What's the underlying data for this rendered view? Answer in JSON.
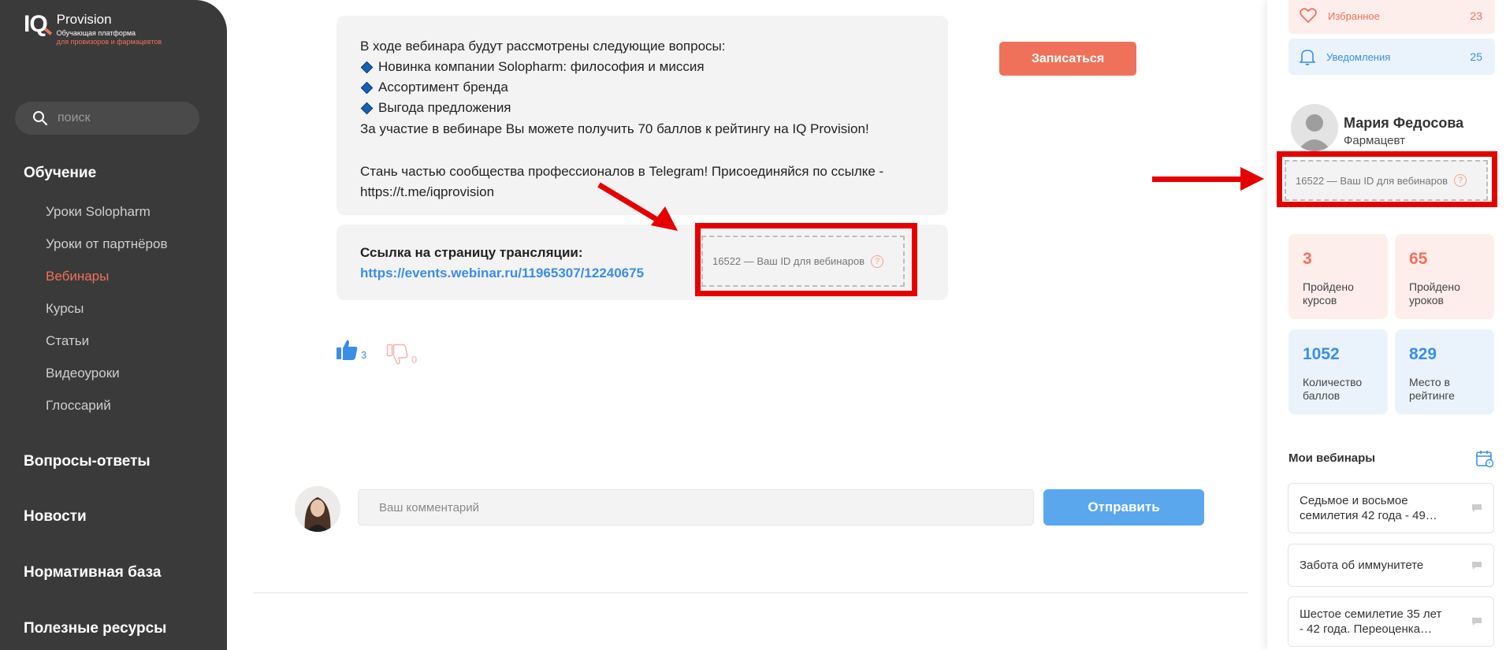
{
  "logo": {
    "iq": "IQ",
    "name": "Provision",
    "sub1": "Обучающая платформа",
    "sub2": "для провизоров и фармацевтов"
  },
  "search": {
    "placeholder": "поиск"
  },
  "nav": {
    "learning": "Обучение",
    "learning_items": [
      "Уроки Solopharm",
      "Уроки от партнёров",
      "Вебинары",
      "Курсы",
      "Статьи",
      "Видеоуроки",
      "Глоссарий"
    ],
    "qa": "Вопросы-ответы",
    "news": "Новости",
    "regulatory": "Нормативная база",
    "resources": "Полезные ресурсы"
  },
  "webinar": {
    "description": [
      "В ходе вебинара будут рассмотрены следующие вопросы:",
      "Новинка компании Solopharm: философия и миссия",
      "Ассортимент бренда",
      "Выгода предложения",
      "За участие в вебинаре Вы можете получить 70 баллов к рейтингу на IQ Provision!",
      "Стань частью сообщества профессионалов в Telegram! Присоединяйся по ссылке -",
      "https://t.me/iqprovision"
    ],
    "signup_label": "Записаться",
    "broadcast_label": "Ссылка на страницу трансляции:",
    "broadcast_url": "https://events.webinar.ru/11965307/12240675",
    "id_text": "16522 — Ваш ID для вебинаров",
    "likes": "3",
    "dislikes": "0"
  },
  "comment": {
    "placeholder": "Ваш комментарий",
    "send_label": "Отправить"
  },
  "right_panel": {
    "favorites_label": "Избранное",
    "favorites_count": "23",
    "notifications_label": "Уведомления",
    "notifications_count": "25",
    "profile_name": "Мария Федосова",
    "profile_role": "Фармацевт",
    "id_text": "16522 — Ваш ID для вебинаров",
    "stats": [
      {
        "value": "3",
        "label1": "Пройдено",
        "label2": "курсов"
      },
      {
        "value": "65",
        "label1": "Пройдено",
        "label2": "уроков"
      },
      {
        "value": "1052",
        "label1": "Количество",
        "label2": "баллов"
      },
      {
        "value": "829",
        "label1": "Место в",
        "label2": "рейтинге"
      }
    ],
    "my_webinars_title": "Мои вебинары",
    "my_webinars": [
      {
        "line1": "Седьмое и восьмое",
        "line2": "семилетия 42 года - 49…"
      },
      {
        "line1": "Забота об иммунитете",
        "line2": ""
      },
      {
        "line1": "Шестое семилетие 35 лет",
        "line2": "- 42 года. Переоценка…"
      }
    ]
  },
  "colors": {
    "sidebar_bg": "#3a3a3a",
    "accent_orange": "#f0715a",
    "accent_blue": "#3b8ee8",
    "annotation_red": "#e60000"
  }
}
